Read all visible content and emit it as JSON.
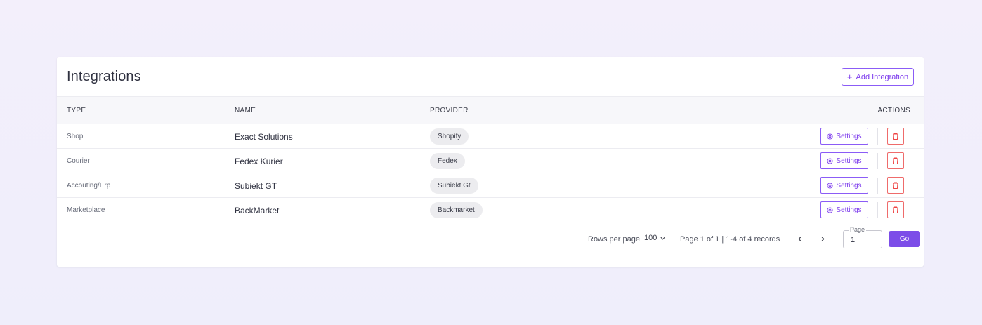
{
  "header": {
    "title": "Integrations",
    "add_label": "Add Integration",
    "add_icon": "plus-icon"
  },
  "table": {
    "columns": [
      "TYPE",
      "NAME",
      "PROVIDER",
      "ACTIONS"
    ],
    "rows": [
      {
        "type": "Shop",
        "name": "Exact Solutions",
        "provider": "Shopify",
        "settings_label": "Settings"
      },
      {
        "type": "Courier",
        "name": "Fedex Kurier",
        "provider": "Fedex",
        "settings_label": "Settings"
      },
      {
        "type": "Accouting/Erp",
        "name": "Subiekt GT",
        "provider": "Subiekt Gt",
        "settings_label": "Settings"
      },
      {
        "type": "Marketplace",
        "name": "BackMarket",
        "provider": "Backmarket",
        "settings_label": "Settings"
      }
    ]
  },
  "pagination": {
    "rows_per_page_label": "Rows per page",
    "rows_per_page_value": "100",
    "page_info": "Page 1 of 1 | 1-4 of 4 records",
    "page_field_label": "Page",
    "page_field_value": "1",
    "go_label": "Go"
  },
  "colors": {
    "accent": "#7c3aed",
    "danger": "#ef4444"
  }
}
